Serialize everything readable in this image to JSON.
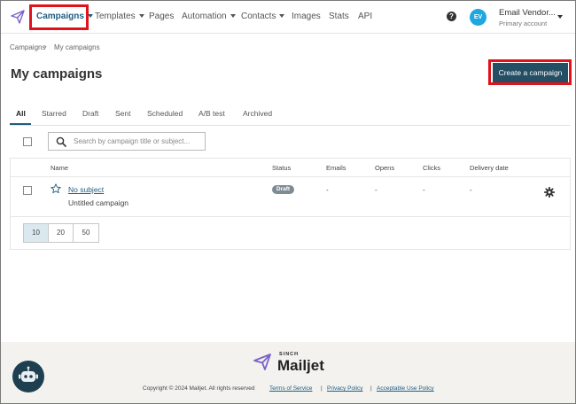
{
  "nav": {
    "items": [
      {
        "label": "Campaigns",
        "has_caret": true,
        "active": true
      },
      {
        "label": "Templates",
        "has_caret": true
      },
      {
        "label": "Pages",
        "has_caret": false
      },
      {
        "label": "Automation",
        "has_caret": true
      },
      {
        "label": "Contacts",
        "has_caret": true
      },
      {
        "label": "Images",
        "has_caret": false
      },
      {
        "label": "Stats",
        "has_caret": false
      },
      {
        "label": "API",
        "has_caret": false
      }
    ],
    "help_glyph": "?",
    "avatar_initials": "EV",
    "account_name": "Email Vendor...",
    "account_sub": "Primary account"
  },
  "breadcrumb": {
    "root": "Campaigns",
    "separator": "›",
    "current": "My campaigns"
  },
  "page": {
    "title": "My campaigns",
    "create_label": "Create a campaign"
  },
  "tabs": [
    "All",
    "Starred",
    "Draft",
    "Sent",
    "Scheduled",
    "A/B test",
    "Archived"
  ],
  "active_tab": "All",
  "search": {
    "placeholder": "Search by campaign title or subject..."
  },
  "table": {
    "columns": [
      "Name",
      "Status",
      "Emails",
      "Opens",
      "Clicks",
      "Delivery date"
    ],
    "rows": [
      {
        "subject": "No subject",
        "campaign": "Untitled campaign",
        "status": "Draft",
        "emails": "-",
        "opens": "-",
        "clicks": "-",
        "delivery": "-"
      }
    ]
  },
  "pagination": {
    "options": [
      "10",
      "20",
      "50"
    ],
    "selected": "10"
  },
  "footer": {
    "sinch": "SINCH",
    "brand": "Mailjet",
    "copyright": "Copyright © 2024 Mailjet. All rights reserved",
    "links": [
      "Terms of Service",
      "Privacy Policy",
      "Acceptable Use Policy"
    ],
    "sep": "|"
  },
  "colors": {
    "accent": "#1e5d82",
    "primary_button": "#234e63",
    "highlight": "#e0121b",
    "avatar": "#1ea7e1",
    "badge": "#7d8b95"
  },
  "icons": [
    "send-logo-icon",
    "help-icon",
    "chevron-down-icon",
    "search-icon",
    "star-icon",
    "gear-icon",
    "chatbot-icon"
  ]
}
